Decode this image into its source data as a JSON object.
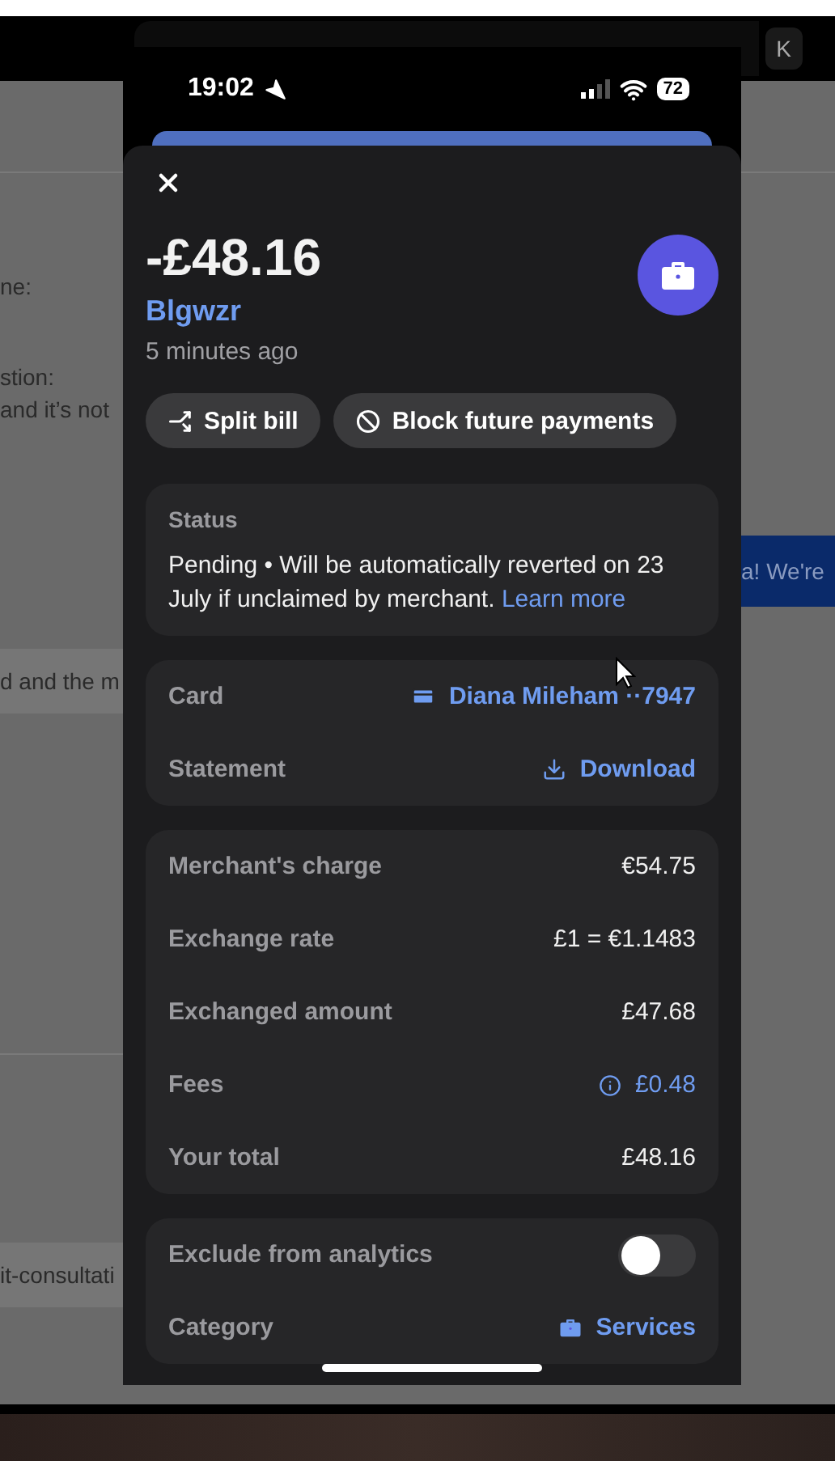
{
  "background_page": {
    "shortcut_keys": [
      "K"
    ],
    "left_fragments": [
      {
        "text": "ne:",
        "kind": "line"
      },
      {
        "text": "stion:",
        "kind": "line"
      },
      {
        "text": "and it’s not",
        "kind": "line"
      },
      {
        "text": "d and the m",
        "kind": "box"
      },
      {
        "text": "it-consultati",
        "kind": "box"
      }
    ],
    "banner_fragment": "a! We're"
  },
  "status_bar": {
    "time": "19:02",
    "battery": "72"
  },
  "transaction": {
    "amount": "-£48.16",
    "merchant": "Blgwzr",
    "time": "5 minutes ago"
  },
  "actions": [
    {
      "label": "Split bill",
      "kind": "split"
    },
    {
      "label": "Block future payments",
      "kind": "block"
    }
  ],
  "status": {
    "title": "Status",
    "text": "Pending • Will be automatically reverted on 23 July if unclaimed by merchant.",
    "link": "Learn more"
  },
  "details": [
    {
      "label": "Card",
      "value": "Diana Mileham ··7947",
      "kind": "card"
    },
    {
      "label": "Statement",
      "value": "Download",
      "kind": "download"
    }
  ],
  "breakdown": [
    {
      "label": "Merchant's charge",
      "value": "€54.75",
      "kind": "plain"
    },
    {
      "label": "Exchange rate",
      "value": "£1 = €1.1483",
      "kind": "plain"
    },
    {
      "label": "Exchanged amount",
      "value": "£47.68",
      "kind": "plain"
    },
    {
      "label": "Fees",
      "value": "£0.48",
      "kind": "info"
    },
    {
      "label": "Your total",
      "value": "£48.16",
      "kind": "plain"
    }
  ],
  "settings": [
    {
      "label": "Exclude from analytics",
      "kind": "toggle",
      "on": false
    },
    {
      "label": "Category",
      "kind": "category",
      "value": "Services"
    }
  ]
}
